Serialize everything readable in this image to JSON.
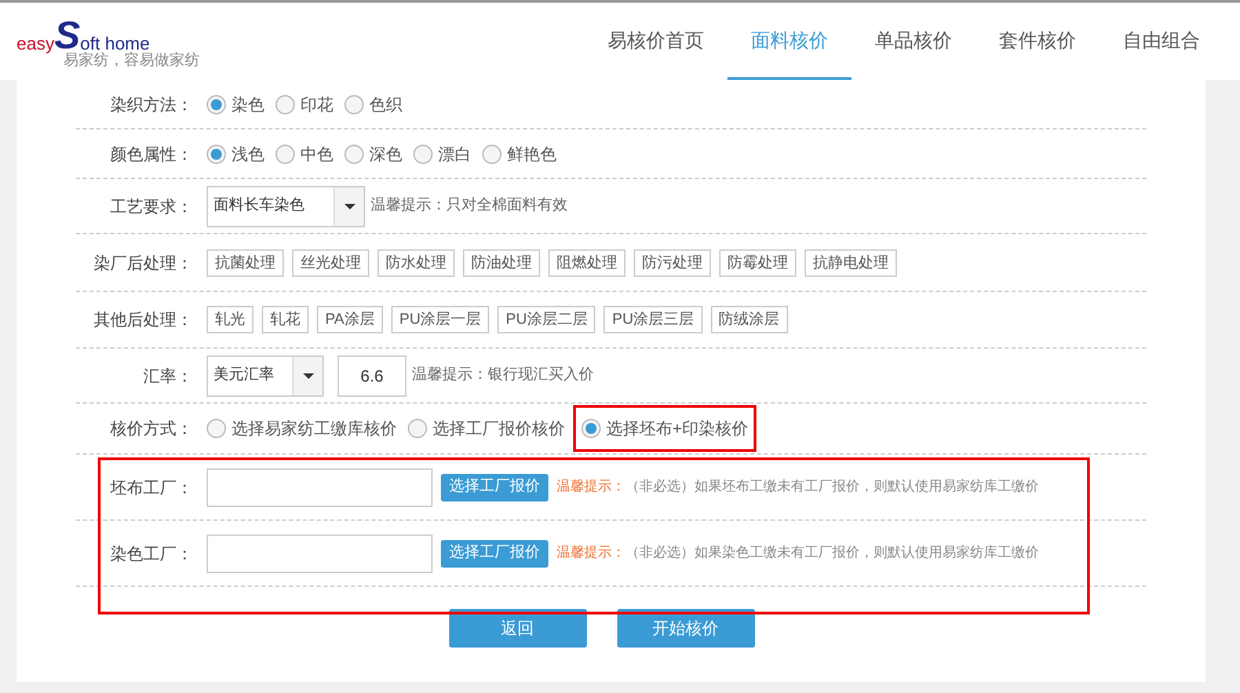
{
  "logo": {
    "prefix": "easy",
    "mark": "S",
    "suffix": "oft home",
    "tagline": "易家纺，容易做家纺"
  },
  "nav": [
    {
      "label": "易核价首页",
      "selected": false
    },
    {
      "label": "面料核价",
      "selected": true
    },
    {
      "label": "单品核价",
      "selected": false
    },
    {
      "label": "套件核价",
      "selected": false
    },
    {
      "label": "自由组合",
      "selected": false
    }
  ],
  "rows": [
    {
      "kind": "radio",
      "label": "染织方法：",
      "options": [
        {
          "label": "染色",
          "selected": true
        },
        {
          "label": "印花",
          "selected": false
        },
        {
          "label": "色织",
          "selected": false
        }
      ]
    },
    {
      "kind": "radio",
      "label": "颜色属性：",
      "options": [
        {
          "label": "浅色",
          "selected": true
        },
        {
          "label": "中色",
          "selected": false
        },
        {
          "label": "深色",
          "selected": false
        },
        {
          "label": "漂白",
          "selected": false
        },
        {
          "label": "鲜艳色",
          "selected": false
        }
      ]
    },
    {
      "kind": "select",
      "label": "工艺要求：",
      "value": "面料长车染色",
      "hint": "温馨提示：只对全棉面料有效"
    },
    {
      "kind": "tags",
      "label": "染厂后处理：",
      "tags": [
        "抗菌处理",
        "丝光处理",
        "防水处理",
        "防油处理",
        "阻燃处理",
        "防污处理",
        "防霉处理",
        "抗静电处理"
      ]
    },
    {
      "kind": "tags",
      "label": "其他后处理：",
      "tags": [
        "轧光",
        "轧花",
        "PA涂层",
        "PU涂层一层",
        "PU涂层二层",
        "PU涂层三层",
        "防绒涂层"
      ]
    },
    {
      "kind": "rate",
      "label": "汇率：",
      "value": "美元汇率",
      "amount": "6.6",
      "hint": "温馨提示：银行现汇买入价"
    },
    {
      "kind": "radio",
      "label": "核价方式：",
      "options": [
        {
          "label": "选择易家纺工缴库核价",
          "selected": false
        },
        {
          "label": "选择工厂报价核价",
          "selected": false
        },
        {
          "label": "选择坯布+印染核价",
          "selected": true,
          "highlighted": true
        }
      ]
    }
  ],
  "factories": {
    "highlighted": true,
    "rows": [
      {
        "label": "坯布工厂：",
        "button": "选择工厂报价",
        "hint_title": "温馨提示：",
        "hint": "（非必选）如果坯布工缴未有工厂报价，则默认使用易家纺库工缴价"
      },
      {
        "label": "染色工厂：",
        "button": "选择工厂报价",
        "hint_title": "温馨提示：",
        "hint": "（非必选）如果染色工缴未有工厂报价，则默认使用易家纺库工缴价"
      }
    ]
  },
  "buttons": [
    "返回",
    "开始核价"
  ]
}
